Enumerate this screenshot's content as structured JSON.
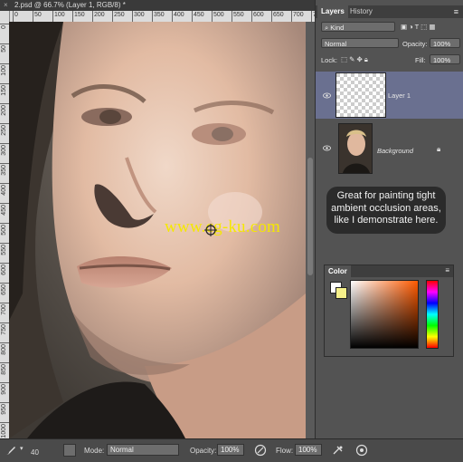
{
  "document": {
    "tab_title": "2.psd @ 66.7% (Layer 1, RGB/8) *",
    "close_glyph": "×",
    "ruler_top_labels": [
      "0",
      "50",
      "100",
      "150",
      "200",
      "250",
      "300",
      "350",
      "400",
      "450",
      "500",
      "550",
      "600",
      "650",
      "700",
      "750"
    ],
    "ruler_left_labels": [
      "0",
      "50",
      "100",
      "150",
      "200",
      "250",
      "300",
      "350",
      "400",
      "450",
      "500",
      "550",
      "600",
      "650",
      "700",
      "750",
      "800",
      "850",
      "900",
      "950",
      "1000"
    ],
    "watermark_text": "www.cg-ku.com"
  },
  "layers_panel": {
    "tabs": [
      "Layers",
      "History"
    ],
    "active_tab": "Layers",
    "filter_label": "Kind",
    "blend_mode": "Normal",
    "opacity_label": "Opacity:",
    "opacity_value": "100%",
    "lock_label": "Lock:",
    "fill_label": "Fill:",
    "fill_value": "100%",
    "layers": [
      {
        "name": "Layer 1",
        "selected": true,
        "visible": true
      },
      {
        "name": "Background",
        "selected": false,
        "visible": true,
        "locked": true
      }
    ]
  },
  "tooltip": {
    "line1": "Great for painting tight",
    "line2": "ambient occlusion areas,",
    "line3": "like I demonstrate here."
  },
  "color_panel": {
    "title": "Color",
    "foreground": "#ffffff",
    "background": "#f6f08a",
    "picker_hue": "#ff5a00"
  },
  "options_bar": {
    "brush_size": "40",
    "mode_label": "Mode:",
    "mode_value": "Normal",
    "opacity_label": "Opacity:",
    "opacity_value": "100%",
    "flow_label": "Flow:",
    "flow_value": "100%"
  },
  "colors": {
    "panel_bg": "#535353",
    "selected_layer": "#6a7090",
    "tooltip_bg": "#2b2b2b",
    "watermark": "#f5e800"
  }
}
